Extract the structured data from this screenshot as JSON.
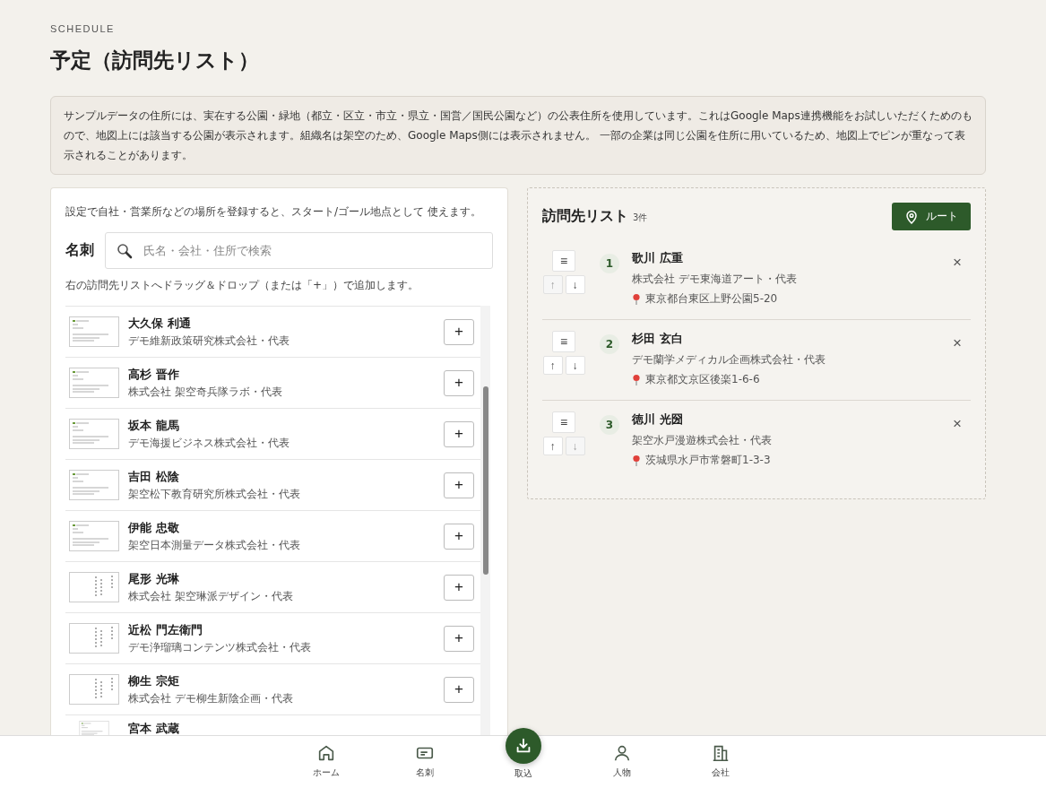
{
  "header": {
    "eyebrow": "SCHEDULE",
    "title": "予定（訪問先リスト）"
  },
  "notice": "サンプルデータの住所には、実在する公園・緑地（都立・区立・市立・県立・国営／国民公園など）の公表住所を使用しています。これはGoogle Maps連携機能をお試しいただくためのもので、地図上には該当する公園が表示されます。組織名は架空のため、Google Maps側には表示されません。 一部の企業は同じ公園を住所に用いているため、地図上でピンが重なって表示されることがあります。",
  "cards_panel": {
    "hint": "設定で自社・営業所などの場所を登録すると、スタート/ゴール地点として 使えます。",
    "label": "名刺",
    "search": {
      "placeholder": "氏名・会社・住所で検索"
    },
    "drag_hint": "右の訪問先リストへドラッグ＆ドロップ（または「+」）で追加します。",
    "cards": [
      {
        "name": "大久保 利通",
        "company": "デモ維新政策研究株式会社・代表",
        "kind": "horizontal",
        "add": "+"
      },
      {
        "name": "高杉 晋作",
        "company": "株式会社 架空奇兵隊ラボ・代表",
        "kind": "horizontal",
        "add": "+"
      },
      {
        "name": "坂本 龍馬",
        "company": "デモ海援ビジネス株式会社・代表",
        "kind": "horizontal",
        "add": "+"
      },
      {
        "name": "吉田 松陰",
        "company": "架空松下教育研究所株式会社・代表",
        "kind": "horizontal",
        "add": "+"
      },
      {
        "name": "伊能 忠敬",
        "company": "架空日本測量データ株式会社・代表",
        "kind": "horizontal",
        "add": "+"
      },
      {
        "name": "尾形 光琳",
        "company": "株式会社 架空琳派デザイン・代表",
        "kind": "vertical",
        "add": "+"
      },
      {
        "name": "近松 門左衛門",
        "company": "デモ浄瑠璃コンテンツ株式会社・代表",
        "kind": "vertical",
        "add": "+"
      },
      {
        "name": "柳生 宗矩",
        "company": "株式会社 デモ柳生新陰企画・代表",
        "kind": "vertical",
        "add": "+"
      },
      {
        "name": "宮本 武蔵",
        "kind": "horizontal"
      }
    ]
  },
  "visit_panel": {
    "title": "訪問先リスト",
    "count": "3件",
    "route_button": "ルート",
    "visits": [
      {
        "number": "1",
        "name": "歌川 広重",
        "company": "株式会社 デモ東海道アート・代表",
        "address": "東京都台東区上野公園5-20",
        "up_disabled": true,
        "down_disabled": false,
        "drag": "≡",
        "up": "↑",
        "down": "↓",
        "remove": "×"
      },
      {
        "number": "2",
        "name": "杉田 玄白",
        "company": "デモ蘭学メディカル企画株式会社・代表",
        "address": "東京都文京区後楽1-6-6",
        "up_disabled": false,
        "down_disabled": false,
        "drag": "≡",
        "up": "↑",
        "down": "↓",
        "remove": "×"
      },
      {
        "number": "3",
        "name": "徳川 光圀",
        "company": "架空水戸漫遊株式会社・代表",
        "address": "茨城県水戸市常磐町1-3-3",
        "up_disabled": false,
        "down_disabled": true,
        "drag": "≡",
        "up": "↑",
        "down": "↓",
        "remove": "×"
      }
    ]
  },
  "bottom_nav": [
    {
      "label": "ホーム",
      "kind": "home"
    },
    {
      "label": "名刺",
      "kind": "card"
    },
    {
      "label": "取込",
      "kind": "import"
    },
    {
      "label": "人物",
      "kind": "person"
    },
    {
      "label": "会社",
      "kind": "company"
    }
  ]
}
